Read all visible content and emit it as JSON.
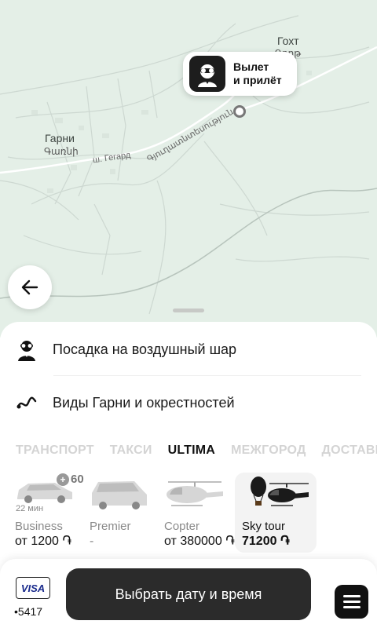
{
  "map": {
    "places": {
      "garni": "Гарни",
      "garni_arm": "Գառնի",
      "gokht": "Гохт",
      "gokht_arm": "Գողթ",
      "street_geghard": "ш. Гегард",
      "street_arm": "Գյուղատնտեսություն"
    },
    "pin_label_line1": "Вылет",
    "pin_label_line2": "и прилёт"
  },
  "sheet": {
    "destinations": [
      {
        "label": "Посадка на воздушный шар",
        "icon": "pilot-icon"
      },
      {
        "label": "Виды Гарни и окрестностей",
        "icon": "route-icon"
      }
    ],
    "tabs": [
      {
        "label": "ТРАНСПОРТ",
        "active": false
      },
      {
        "label": "ТАКСИ",
        "active": false
      },
      {
        "label": "ULTIMA",
        "active": true
      },
      {
        "label": "МЕЖГОРОД",
        "active": false
      },
      {
        "label": "ДОСТАВКА",
        "active": false
      }
    ],
    "tariffs": [
      {
        "name": "Business",
        "price": "от 1200 ֏",
        "eta": "22 мин",
        "badge": "60",
        "icon": "suv-car-icon",
        "selected": false
      },
      {
        "name": "Premier",
        "price": "-",
        "icon": "minivan-icon",
        "selected": false
      },
      {
        "name": "Copter",
        "price": "от 380000 ֏",
        "icon": "helicopter-icon",
        "selected": false
      },
      {
        "name": "Sky tour",
        "price": "71200 ֏",
        "icon": "balloon-helicopter-icon",
        "selected": true
      }
    ]
  },
  "bottom": {
    "payment_brand": "VISA",
    "card_last4": "•5417",
    "main_button": "Выбрать дату и время"
  },
  "colors": {
    "map_bg": "#e4efe7",
    "button_dark": "#2b2b2b",
    "tab_inactive": "#d4d4d4"
  }
}
